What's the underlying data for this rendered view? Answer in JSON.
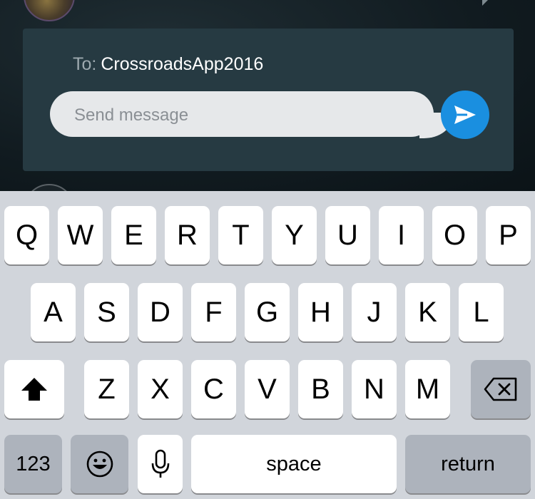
{
  "dm": {
    "to_label": "To:",
    "recipient": "CrossroadsApp2016",
    "placeholder": "Send message",
    "send_icon": "send-icon"
  },
  "keyboard": {
    "row1": [
      "Q",
      "W",
      "E",
      "R",
      "T",
      "Y",
      "U",
      "I",
      "O",
      "P"
    ],
    "row2": [
      "A",
      "S",
      "D",
      "F",
      "G",
      "H",
      "J",
      "K",
      "L"
    ],
    "row3": [
      "Z",
      "X",
      "C",
      "V",
      "B",
      "N",
      "M"
    ],
    "numbers_label": "123",
    "space_label": "space",
    "return_label": "return",
    "icons": {
      "shift": "shift-icon",
      "backspace": "backspace-icon",
      "emoji": "emoji-icon",
      "mic": "microphone-icon"
    }
  },
  "colors": {
    "panel": "#263a42",
    "send_button": "#1a8fe0",
    "keyboard_bg": "#d1d5db",
    "function_key": "#adb3bc"
  }
}
